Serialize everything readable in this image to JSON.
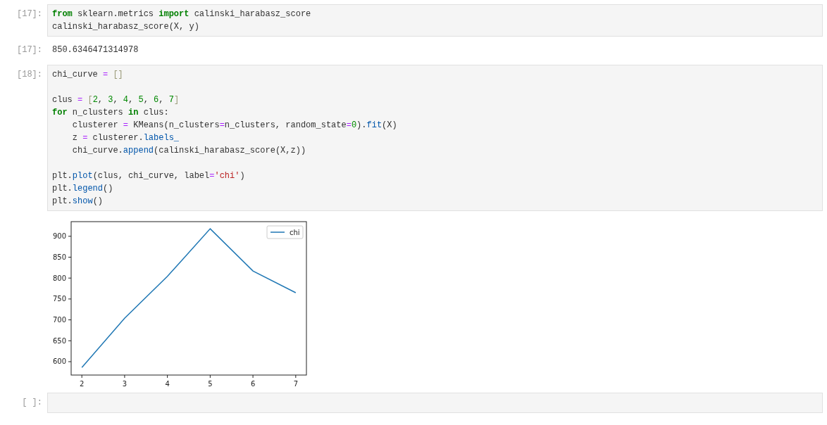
{
  "cells": [
    {
      "kind": "code",
      "prompt": "[17]:",
      "lines": [
        {
          "kind": "code",
          "tokens": [
            {
              "kind": "keyword",
              "text": "from"
            },
            {
              "kind": "name",
              "text": " sklearn.metrics "
            },
            {
              "kind": "keyword",
              "text": "import"
            },
            {
              "kind": "name",
              "text": " calinski_harabasz_score"
            }
          ]
        },
        {
          "kind": "code",
          "tokens": [
            {
              "kind": "name",
              "text": "calinski_harabasz_score(X, y)"
            }
          ]
        }
      ]
    },
    {
      "kind": "output",
      "prompt": "[17]:",
      "text": "850.6346471314978"
    },
    {
      "kind": "code",
      "prompt": "[18]:",
      "lines": [
        {
          "kind": "code",
          "tokens": [
            {
              "kind": "name",
              "text": "chi_curve "
            },
            {
              "kind": "operator",
              "text": "="
            },
            {
              "kind": "bracket",
              "text": " []"
            }
          ]
        },
        {
          "kind": "blank"
        },
        {
          "kind": "code",
          "tokens": [
            {
              "kind": "name",
              "text": "clus "
            },
            {
              "kind": "operator",
              "text": "="
            },
            {
              "kind": "bracket",
              "text": " ["
            },
            {
              "kind": "number",
              "text": "2"
            },
            {
              "kind": "name",
              "text": ", "
            },
            {
              "kind": "number",
              "text": "3"
            },
            {
              "kind": "name",
              "text": ", "
            },
            {
              "kind": "number",
              "text": "4"
            },
            {
              "kind": "name",
              "text": ", "
            },
            {
              "kind": "number",
              "text": "5"
            },
            {
              "kind": "name",
              "text": ", "
            },
            {
              "kind": "number",
              "text": "6"
            },
            {
              "kind": "name",
              "text": ", "
            },
            {
              "kind": "number",
              "text": "7"
            },
            {
              "kind": "bracket",
              "text": "]"
            }
          ]
        },
        {
          "kind": "code",
          "tokens": [
            {
              "kind": "keyword",
              "text": "for"
            },
            {
              "kind": "name",
              "text": " n_clusters "
            },
            {
              "kind": "keyword",
              "text": "in"
            },
            {
              "kind": "name",
              "text": " clus:"
            }
          ]
        },
        {
          "kind": "code",
          "tokens": [
            {
              "kind": "name",
              "text": "    clusterer "
            },
            {
              "kind": "operator",
              "text": "="
            },
            {
              "kind": "name",
              "text": " KMeans(n_clusters"
            },
            {
              "kind": "operator",
              "text": "="
            },
            {
              "kind": "name",
              "text": "n_clusters, random_state"
            },
            {
              "kind": "operator",
              "text": "="
            },
            {
              "kind": "number",
              "text": "0"
            },
            {
              "kind": "name",
              "text": ")."
            },
            {
              "kind": "attribute",
              "text": "fit"
            },
            {
              "kind": "name",
              "text": "(X)"
            }
          ]
        },
        {
          "kind": "code",
          "tokens": [
            {
              "kind": "name",
              "text": "    z "
            },
            {
              "kind": "operator",
              "text": "="
            },
            {
              "kind": "name",
              "text": " clusterer."
            },
            {
              "kind": "attribute",
              "text": "labels_"
            }
          ]
        },
        {
          "kind": "code",
          "tokens": [
            {
              "kind": "name",
              "text": "    chi_curve."
            },
            {
              "kind": "attribute",
              "text": "append"
            },
            {
              "kind": "name",
              "text": "(calinski_harabasz_score(X,z))"
            }
          ]
        },
        {
          "kind": "blank"
        },
        {
          "kind": "code",
          "tokens": [
            {
              "kind": "name",
              "text": "plt."
            },
            {
              "kind": "attribute",
              "text": "plot"
            },
            {
              "kind": "name",
              "text": "(clus, chi_curve, label"
            },
            {
              "kind": "operator",
              "text": "="
            },
            {
              "kind": "string",
              "text": "'chi'"
            },
            {
              "kind": "name",
              "text": ")"
            }
          ]
        },
        {
          "kind": "code",
          "tokens": [
            {
              "kind": "name",
              "text": "plt."
            },
            {
              "kind": "attribute",
              "text": "legend"
            },
            {
              "kind": "name",
              "text": "()"
            }
          ]
        },
        {
          "kind": "code",
          "tokens": [
            {
              "kind": "name",
              "text": "plt."
            },
            {
              "kind": "attribute",
              "text": "show"
            },
            {
              "kind": "name",
              "text": "()"
            }
          ]
        }
      ]
    },
    {
      "kind": "chart",
      "chart_data": {
        "type": "line",
        "x": [
          2,
          3,
          4,
          5,
          6,
          7
        ],
        "series": [
          {
            "name": "chi",
            "color": "#1f77b4",
            "values": [
              586,
              704,
              804,
              918,
              817,
              765
            ]
          }
        ],
        "xlim": [
          1.75,
          7.25
        ],
        "ylim": [
          568,
          935
        ],
        "xticks": [
          2,
          3,
          4,
          5,
          6,
          7
        ],
        "yticks": [
          600,
          650,
          700,
          750,
          800,
          850,
          900
        ]
      }
    },
    {
      "kind": "code",
      "prompt": "[ ]:"
    }
  ]
}
